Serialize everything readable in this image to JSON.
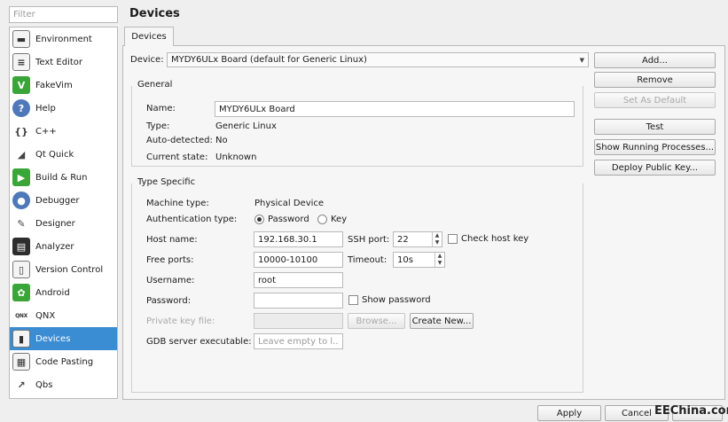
{
  "filter": {
    "placeholder": "Filter"
  },
  "sidebar": {
    "items": [
      {
        "label": "Environment",
        "icon": "environment-icon",
        "glyph": "▬"
      },
      {
        "label": "Text Editor",
        "icon": "text-editor-icon",
        "glyph": "≡"
      },
      {
        "label": "FakeVim",
        "icon": "fakevim-icon",
        "glyph": "V"
      },
      {
        "label": "Help",
        "icon": "help-icon",
        "glyph": "?"
      },
      {
        "label": "C++",
        "icon": "cpp-icon",
        "glyph": "{}"
      },
      {
        "label": "Qt Quick",
        "icon": "qt-quick-icon",
        "glyph": "◢"
      },
      {
        "label": "Build & Run",
        "icon": "build-run-icon",
        "glyph": "▶"
      },
      {
        "label": "Debugger",
        "icon": "debugger-icon",
        "glyph": "●"
      },
      {
        "label": "Designer",
        "icon": "designer-icon",
        "glyph": "✎"
      },
      {
        "label": "Analyzer",
        "icon": "analyzer-icon",
        "glyph": "▤"
      },
      {
        "label": "Version Control",
        "icon": "version-control-icon",
        "glyph": "▯"
      },
      {
        "label": "Android",
        "icon": "android-icon",
        "glyph": "✿"
      },
      {
        "label": "QNX",
        "icon": "qnx-icon",
        "glyph": "QNX"
      },
      {
        "label": "Devices",
        "icon": "devices-icon",
        "glyph": "▮"
      },
      {
        "label": "Code Pasting",
        "icon": "code-pasting-icon",
        "glyph": "▦"
      },
      {
        "label": "Qbs",
        "icon": "qbs-icon",
        "glyph": "↗"
      }
    ]
  },
  "page": {
    "title": "Devices",
    "tab": "Devices"
  },
  "device": {
    "label": "Device:",
    "selected": "MYDY6ULx Board (default for Generic Linux)"
  },
  "general": {
    "title": "General",
    "name_label": "Name:",
    "name_value": "MYDY6ULx Board",
    "type_label": "Type:",
    "type_value": "Generic Linux",
    "auto_label": "Auto-detected:",
    "auto_value": "No",
    "state_label": "Current state:",
    "state_value": "Unknown"
  },
  "specific": {
    "title": "Type Specific",
    "machine_label": "Machine type:",
    "machine_value": "Physical Device",
    "auth_label": "Authentication type:",
    "auth_password": "Password",
    "auth_key": "Key",
    "host_label": "Host name:",
    "host_value": "192.168.30.1",
    "ssh_label": "SSH port:",
    "ssh_value": "22",
    "check_host_key": "Check host key",
    "ports_label": "Free ports:",
    "ports_value": "10000-10100",
    "timeout_label": "Timeout:",
    "timeout_value": "10s",
    "user_label": "Username:",
    "user_value": "root",
    "password_label": "Password:",
    "password_value": "",
    "show_password": "Show password",
    "keyfile_label": "Private key file:",
    "browse": "Browse...",
    "create_new": "Create New...",
    "gdb_label": "GDB server executable:",
    "gdb_placeholder": "Leave empty to l..."
  },
  "actions": {
    "add": "Add...",
    "remove": "Remove",
    "set_default": "Set As Default",
    "test": "Test",
    "show_processes": "Show Running Processes...",
    "deploy_key": "Deploy Public Key..."
  },
  "footer": {
    "apply": "Apply",
    "cancel": "Cancel",
    "watermark": "EEChina.com"
  }
}
